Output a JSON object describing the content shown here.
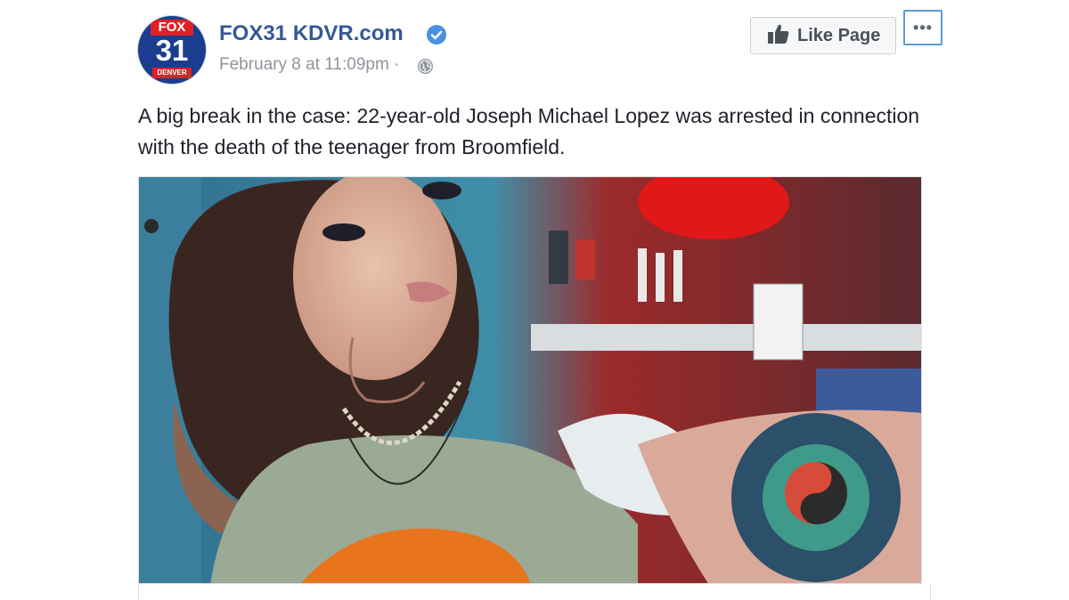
{
  "post": {
    "page_name": "FOX31 KDVR.com",
    "timestamp": "February 8 at 11:09pm",
    "separator": "·",
    "text": "A big break in the case: 22-year-old Joseph Michael Lopez was arrested in connection with the death of the teenager from Broomfield.",
    "avatar": {
      "top": "FOX",
      "number": "31",
      "city": "DENVER"
    }
  },
  "actions": {
    "like_page_label": "Like Page",
    "more_label": "•••"
  },
  "icons": {
    "verified": "verified-badge-icon",
    "audience": "globe-icon",
    "like": "thumbs-up-icon",
    "more": "more-options-icon"
  },
  "colors": {
    "page_link": "#365899",
    "meta_text": "#90949c",
    "verified": "#4a90e2",
    "fox_red": "#e02027",
    "fox_blue": "#1a3d8f"
  }
}
